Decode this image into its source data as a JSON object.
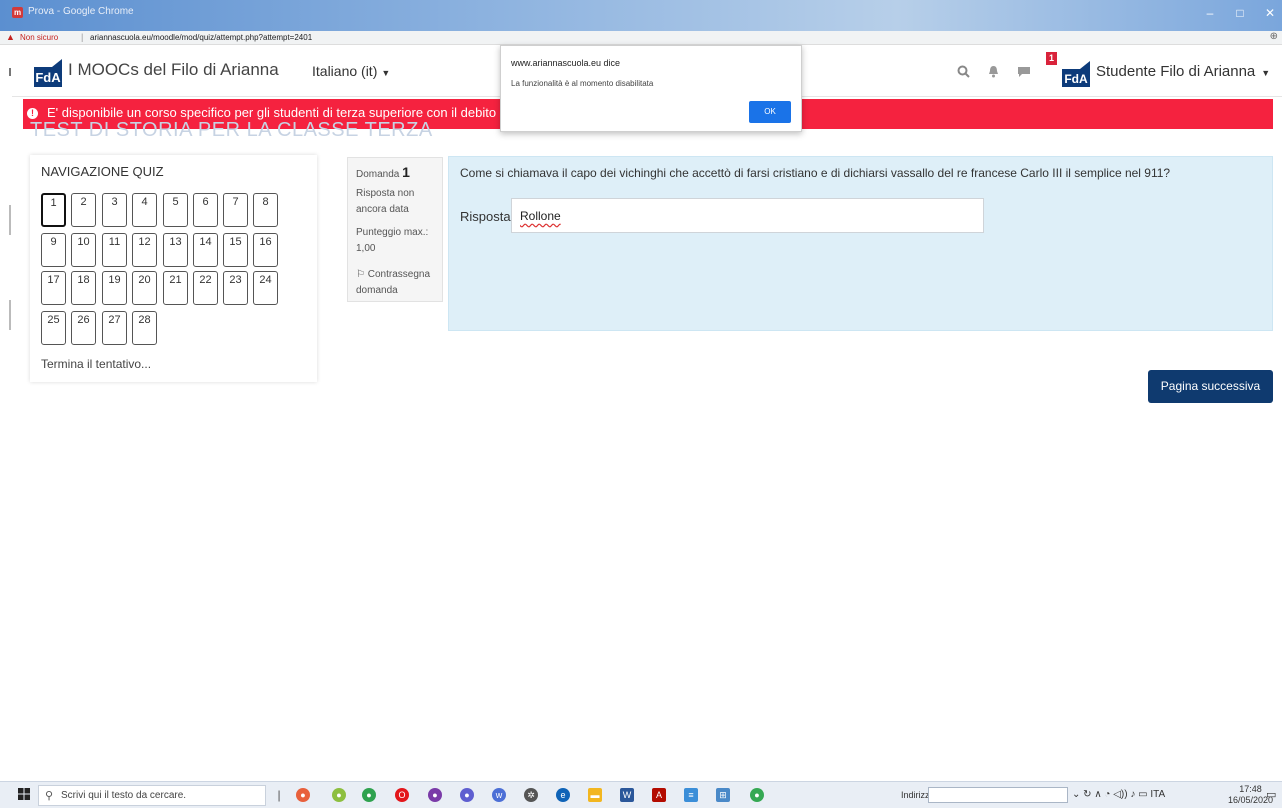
{
  "window": {
    "title": "Prova - Google Chrome",
    "minimize": "–",
    "maximize": "□",
    "close": "✕"
  },
  "addressbar": {
    "security": "Non sicuro",
    "url": "ariannascuola.eu/moodle/mod/quiz/attempt.php?attempt=2401"
  },
  "header": {
    "logo": "FdA",
    "site_name": "I MOOCs del Filo di Arianna",
    "language": "Italiano (it)",
    "messages_badge": "1",
    "user_name": "Studente Filo di Arianna"
  },
  "alert": {
    "text": "E' disponibile un corso specifico per gli studenti di terza superiore con il debito in storia"
  },
  "page_heading": "TEST DI STORIA PER LA CLASSE TERZA",
  "quiz_nav": {
    "title": "NAVIGAZIONE QUIZ",
    "questions": [
      "1",
      "2",
      "3",
      "4",
      "5",
      "6",
      "7",
      "8",
      "9",
      "10",
      "11",
      "12",
      "13",
      "14",
      "15",
      "16",
      "17",
      "18",
      "19",
      "20",
      "21",
      "22",
      "23",
      "24",
      "25",
      "26",
      "27",
      "28"
    ],
    "current": 1,
    "finish_link": "Termina il tentativo..."
  },
  "question": {
    "label": "Domanda",
    "number": "1",
    "state": "Risposta non ancora data",
    "grade": "Punteggio max.: 1,00",
    "flag": "Contrassegna domanda",
    "text": "Come si chiamava il capo dei vichinghi che accettò di farsi cristiano e di dichiarsi vassallo del re francese Carlo III il semplice nel 911?",
    "answer_label": "Risposta:",
    "answer_value": "Rollone"
  },
  "next_button": "Pagina successiva",
  "dialog": {
    "title": "www.ariannascuola.eu dice",
    "message": "La funzionalità è al momento disabilitata",
    "ok": "OK"
  },
  "taskbar": {
    "search_placeholder": "Scrivi qui il testo da cercare.",
    "address_label": "Indirizzo",
    "language": "ITA",
    "time": "17:48",
    "date": "16/05/2020"
  },
  "colors": {
    "alert": "#f5223f",
    "primary_button": "#0f3a6f",
    "question_bg": "#deeff8",
    "logo": "#0d3b7a",
    "dialog_ok": "#1a73e8"
  }
}
